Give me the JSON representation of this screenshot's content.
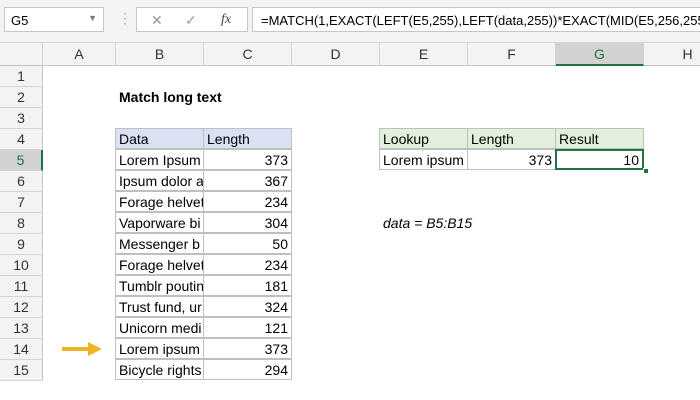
{
  "name_box": "G5",
  "formula": "=MATCH(1,EXACT(LEFT(E5,255),LEFT(data,255))*EXACT(MID(E5,256,255),",
  "columns": [
    "A",
    "B",
    "C",
    "D",
    "E",
    "F",
    "G",
    "H"
  ],
  "rows": [
    "1",
    "2",
    "3",
    "4",
    "5",
    "6",
    "7",
    "8",
    "9",
    "10",
    "11",
    "12",
    "13",
    "14",
    "15"
  ],
  "title": "Match long text",
  "data_table": {
    "headers": [
      "Data",
      "Length"
    ],
    "rows": [
      [
        "Lorem Ipsum",
        "373"
      ],
      [
        "Ipsum dolor a",
        "367"
      ],
      [
        "Forage helvet",
        "234"
      ],
      [
        "Vaporware bi",
        "304"
      ],
      [
        "Messenger b",
        "50"
      ],
      [
        "Forage helvet",
        "234"
      ],
      [
        "Tumblr poutin",
        "181"
      ],
      [
        "Trust fund, ur",
        "324"
      ],
      [
        "Unicorn medi",
        "121"
      ],
      [
        "Lorem ipsum",
        "373"
      ],
      [
        "Bicycle rights",
        "294"
      ]
    ]
  },
  "lookup_table": {
    "headers": [
      "Lookup",
      "Length",
      "Result"
    ],
    "values": [
      "Lorem ipsum",
      "373",
      "10"
    ]
  },
  "note": "data = B5:B15",
  "colors": {
    "data_header": "#d9e1f2",
    "lookup_header": "#e2efda",
    "selection": "#217346",
    "arrow": "#f0b323"
  }
}
